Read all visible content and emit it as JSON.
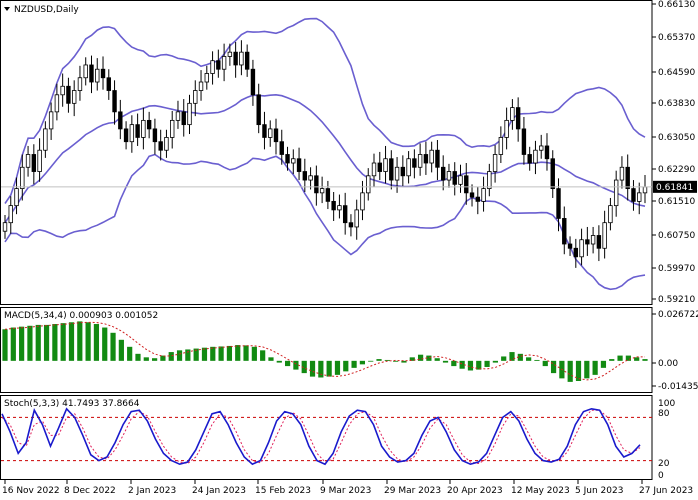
{
  "symbol_title": "NZDUSD,Daily",
  "colors": {
    "background": "#ffffff",
    "frame": "#000000",
    "candle": "#000000",
    "bollinger": "#6a5fd0",
    "price_line": "#c0c0c0",
    "price_label_bg": "#000000",
    "price_label_text": "#ffffff",
    "macd_hist": "#128a12",
    "macd_signal": "#d02020",
    "stoch_main": "#1a1acc",
    "stoch_signal": "#e0205a",
    "stoch_levels": "#cc0000"
  },
  "price_panel": {
    "ticks": [
      "0.66130",
      "0.65370",
      "0.64590",
      "0.63830",
      "0.63050",
      "0.62290",
      "0.61510",
      "0.60750",
      "0.59970",
      "0.59210"
    ],
    "current_price": "0.61841"
  },
  "macd_panel": {
    "label": "MACD(5,34,4) 0.000903 0.001052",
    "ticks": [
      "0.026722",
      "0.00",
      "-0.014353"
    ]
  },
  "stoch_panel": {
    "label": "Stoch(5,3,3) 41.7493 37.8664",
    "ticks": [
      "100",
      "80",
      "20",
      "0"
    ]
  },
  "x_axis": {
    "labels": [
      "16 Nov 2022",
      "8 Dec 2022",
      "2 Jan 2023",
      "24 Jan 2023",
      "15 Feb 2023",
      "9 Mar 2023",
      "29 Mar 2023",
      "20 Apr 2023",
      "12 May 2023",
      "5 Jun 2023",
      "27 Jun 2023"
    ]
  },
  "chart_data": {
    "type": "candlestick",
    "title": "NZDUSD,Daily",
    "closes": [
      0.61,
      0.614,
      0.618,
      0.623,
      0.626,
      0.622,
      0.627,
      0.632,
      0.636,
      0.64,
      0.642,
      0.638,
      0.641,
      0.644,
      0.647,
      0.643,
      0.646,
      0.644,
      0.641,
      0.636,
      0.632,
      0.629,
      0.633,
      0.63,
      0.634,
      0.632,
      0.629,
      0.627,
      0.63,
      0.634,
      0.636,
      0.633,
      0.638,
      0.641,
      0.643,
      0.645,
      0.648,
      0.646,
      0.649,
      0.65,
      0.647,
      0.65,
      0.646,
      0.64,
      0.633,
      0.63,
      0.632,
      0.629,
      0.626,
      0.624,
      0.625,
      0.622,
      0.62,
      0.621,
      0.617,
      0.618,
      0.615,
      0.613,
      0.614,
      0.61,
      0.609,
      0.613,
      0.617,
      0.621,
      0.624,
      0.622,
      0.625,
      0.62,
      0.623,
      0.621,
      0.625,
      0.623,
      0.626,
      0.624,
      0.627,
      0.623,
      0.62,
      0.622,
      0.619,
      0.621,
      0.617,
      0.616,
      0.615,
      0.618,
      0.622,
      0.626,
      0.63,
      0.634,
      0.637,
      0.632,
      0.626,
      0.624,
      0.627,
      0.628,
      0.625,
      0.618,
      0.611,
      0.605,
      0.604,
      0.602,
      0.606,
      0.605,
      0.607,
      0.604,
      0.61,
      0.614,
      0.62,
      0.623,
      0.618,
      0.615,
      0.617,
      0.6184
    ],
    "macd_hist": [
      0.018,
      0.019,
      0.0195,
      0.02,
      0.0205,
      0.0205,
      0.021,
      0.0215,
      0.022,
      0.0225,
      0.022,
      0.021,
      0.019,
      0.016,
      0.012,
      0.008,
      0.004,
      0.002,
      0.0015,
      0.003,
      0.005,
      0.006,
      0.0065,
      0.007,
      0.0075,
      0.008,
      0.0082,
      0.0085,
      0.009,
      0.0088,
      0.008,
      0.006,
      0.002,
      -0.001,
      -0.003,
      -0.005,
      -0.007,
      -0.009,
      -0.0095,
      -0.009,
      -0.008,
      -0.006,
      -0.004,
      -0.002,
      0.0,
      0.001,
      0.0005,
      -0.0005,
      -0.001,
      0.002,
      0.0035,
      0.003,
      0.0015,
      -0.001,
      -0.003,
      -0.0045,
      -0.0055,
      -0.005,
      -0.0035,
      -0.001,
      0.0025,
      0.005,
      0.004,
      0.002,
      0.0005,
      -0.003,
      -0.007,
      -0.01,
      -0.012,
      -0.0115,
      -0.01,
      -0.008,
      -0.004,
      0.001,
      0.003,
      0.003,
      0.002,
      0.001
    ],
    "stoch_main": [
      85,
      60,
      30,
      45,
      90,
      70,
      40,
      65,
      92,
      80,
      55,
      28,
      20,
      25,
      45,
      70,
      88,
      90,
      75,
      50,
      30,
      20,
      15,
      18,
      35,
      60,
      85,
      88,
      70,
      45,
      25,
      15,
      20,
      45,
      75,
      88,
      85,
      70,
      40,
      20,
      15,
      30,
      60,
      82,
      90,
      88,
      70,
      40,
      25,
      18,
      20,
      30,
      55,
      75,
      80,
      60,
      35,
      20,
      15,
      18,
      30,
      55,
      80,
      88,
      75,
      50,
      30,
      20,
      18,
      22,
      40,
      70,
      88,
      92,
      90,
      70,
      40,
      25,
      30,
      42
    ],
    "stoch_signal": [
      80,
      70,
      45,
      40,
      70,
      75,
      55,
      55,
      80,
      85,
      65,
      40,
      25,
      22,
      35,
      55,
      78,
      88,
      82,
      60,
      40,
      25,
      18,
      16,
      25,
      45,
      70,
      85,
      80,
      60,
      35,
      20,
      17,
      30,
      55,
      78,
      87,
      78,
      55,
      30,
      18,
      22,
      45,
      70,
      85,
      88,
      80,
      55,
      35,
      22,
      18,
      25,
      42,
      65,
      78,
      70,
      48,
      28,
      18,
      16,
      22,
      42,
      68,
      85,
      82,
      62,
      40,
      25,
      20,
      20,
      32,
      55,
      78,
      90,
      90,
      80,
      55,
      35,
      30,
      38
    ],
    "price_ylim": [
      0.5921,
      0.6613
    ],
    "macd_ylim": [
      -0.014353,
      0.026722
    ],
    "stoch_ylim": [
      0,
      100
    ],
    "stoch_levels": [
      80,
      20
    ],
    "grid": false
  }
}
